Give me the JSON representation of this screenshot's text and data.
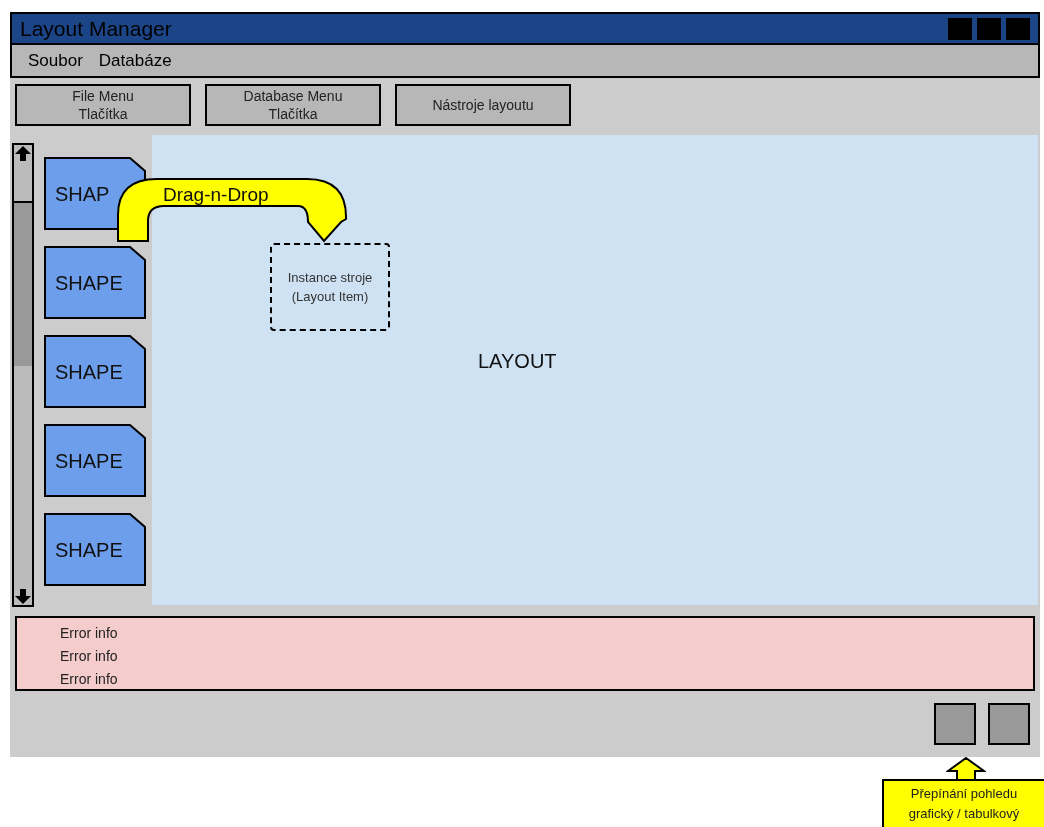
{
  "window": {
    "title": "Layout Manager"
  },
  "menu": [
    {
      "label": "Soubor"
    },
    {
      "label": "Databáze"
    }
  ],
  "toolbar": [
    {
      "label": "File Menu\nTlačítka"
    },
    {
      "label": "Database Menu\nTlačítka"
    },
    {
      "label": "Nástroje layoutu"
    }
  ],
  "palette": [
    {
      "label": "SHAP"
    },
    {
      "label": "SHAPE"
    },
    {
      "label": "SHAPE"
    },
    {
      "label": "SHAPE"
    },
    {
      "label": "SHAPE"
    }
  ],
  "drag_hint": "Drag-n-Drop",
  "layout": {
    "label": "LAYOUT",
    "items": [
      {
        "label": "Instance stroje\n(Layout Item)"
      }
    ]
  },
  "errors": [
    "Error info",
    "Error info",
    "Error info"
  ],
  "view_toggle": {
    "callout": "Přepínání pohledu\ngrafický / tabulkový"
  }
}
